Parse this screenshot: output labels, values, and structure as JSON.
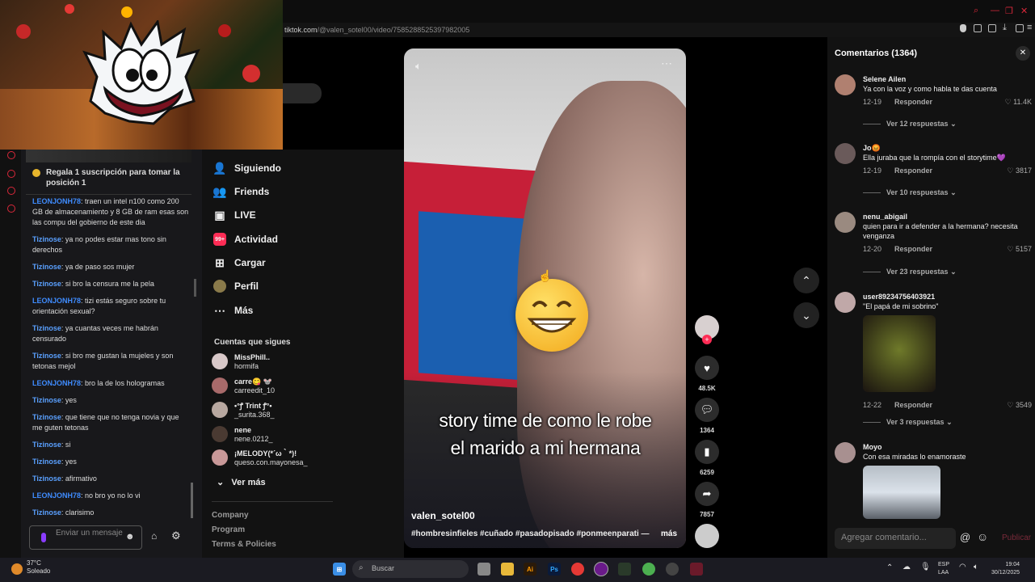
{
  "browser": {
    "url_host": "tiktok.com",
    "url_path": "/@valen_sotel00/video/7585288525397982005"
  },
  "chat": {
    "pinned": "Regala 1 suscripción para tomar la posición 1",
    "messages": [
      {
        "user": "LEONJONH78",
        "text": ": traen un intel n100 como 200 GB de almacenamiento y 8 GB de ram esas son las compu del gobierno de este dia"
      },
      {
        "user": "Tizinose",
        "text": ": ya no podes estar mas tono sin derechos"
      },
      {
        "user": "Tizinose",
        "text": ": ya de paso sos mujer"
      },
      {
        "user": "Tizinose",
        "text": ": si bro la censura me la pela"
      },
      {
        "user": "LEONJONH78",
        "text": ": tizi estás seguro sobre tu orientación sexual?"
      },
      {
        "user": "Tizinose",
        "text": ": ya cuantas veces me habrán censurado"
      },
      {
        "user": "Tizinose",
        "text": ": si bro me gustan la mujeles y son tetonas mejol"
      },
      {
        "user": "LEONJONH78",
        "text": ": bro la de los hologramas"
      },
      {
        "user": "Tizinose",
        "text": ": yes"
      },
      {
        "user": "Tizinose",
        "text": ": que tiene que no tenga novia y que me guten tetonas"
      },
      {
        "user": "Tizinose",
        "text": ": si"
      },
      {
        "user": "Tizinose",
        "text": ": yes"
      },
      {
        "user": "Tizinose",
        "text": ": afirmativo"
      },
      {
        "user": "LEONJONH78",
        "text": ": no bro yo no lo vi"
      },
      {
        "user": "Tizinose",
        "text": ": clarisimo"
      }
    ],
    "input_placeholder": "Enviar un mensaje"
  },
  "sidebar": {
    "nav": [
      {
        "label": "Siguiendo",
        "icon": "following-icon"
      },
      {
        "label": "Friends",
        "icon": "friends-icon"
      },
      {
        "label": "LIVE",
        "icon": "live-icon"
      },
      {
        "label": "Actividad",
        "icon": "activity-icon",
        "badge": "99+"
      },
      {
        "label": "Cargar",
        "icon": "upload-icon"
      },
      {
        "label": "Perfil",
        "icon": "profile-icon"
      },
      {
        "label": "Más",
        "icon": "more-icon"
      }
    ],
    "following_title": "Cuentas que sigues",
    "accounts": [
      {
        "name": "MissPhill..",
        "handle": "hormifa"
      },
      {
        "name": "carre😋 🐭",
        "handle": "carreedit_10"
      },
      {
        "name": "•°ꝭ Trint ꝭ°•",
        "handle": "_surita.368_"
      },
      {
        "name": "nene",
        "handle": "nene.0212_"
      },
      {
        "name": "¡MELODY(*´ω｀*)!",
        "handle": "queso.con.mayonesa_"
      }
    ],
    "see_more": "Ver más",
    "footer": [
      "Company",
      "Program",
      "Terms & Policies"
    ]
  },
  "video": {
    "caption_line1": "story time de como le robe",
    "caption_line2": "el marido a mi hermana",
    "username": "valen_sotel00",
    "hashtags": "#hombresinfieles #cuñado #pasadopisado #ponmeenparati —",
    "more": "más"
  },
  "actions": {
    "likes": "48.5K",
    "comments": "1364",
    "saves": "6259",
    "shares": "7857"
  },
  "comments": {
    "title": "Comentarios (1364)",
    "items": [
      {
        "name": "Selene Ailen",
        "text": "Ya con la voz y como habla te das cuenta",
        "date": "12-19",
        "reply": "Responder",
        "likes": "11.4K",
        "replies": "Ver 12 respuestas"
      },
      {
        "name": "Jo😡",
        "text": "Ella juraba que la rompía con el storytime💜",
        "date": "12-19",
        "reply": "Responder",
        "likes": "3817",
        "replies": "Ver 10 respuestas"
      },
      {
        "name": "nenu_abigail",
        "text": "quien para ir a defender a la hermana? necesita venganza",
        "date": "12-20",
        "reply": "Responder",
        "likes": "5157",
        "replies": "Ver 23 respuestas"
      },
      {
        "name": "user89234756403921",
        "text": "\"El papá de mi sobrino\"",
        "date": "12-22",
        "reply": "Responder",
        "likes": "3549",
        "replies": "Ver 3 respuestas"
      },
      {
        "name": "Moyo",
        "text": "Con esa miradas lo enamoraste"
      }
    ],
    "input_placeholder": "Agregar comentario...",
    "post": "Publicar"
  },
  "taskbar": {
    "temp": "37°C",
    "weather": "Soleado",
    "search": "Buscar",
    "lang1": "ESP",
    "lang2": "LAA",
    "time": "19:04",
    "date": "30/12/2025"
  }
}
